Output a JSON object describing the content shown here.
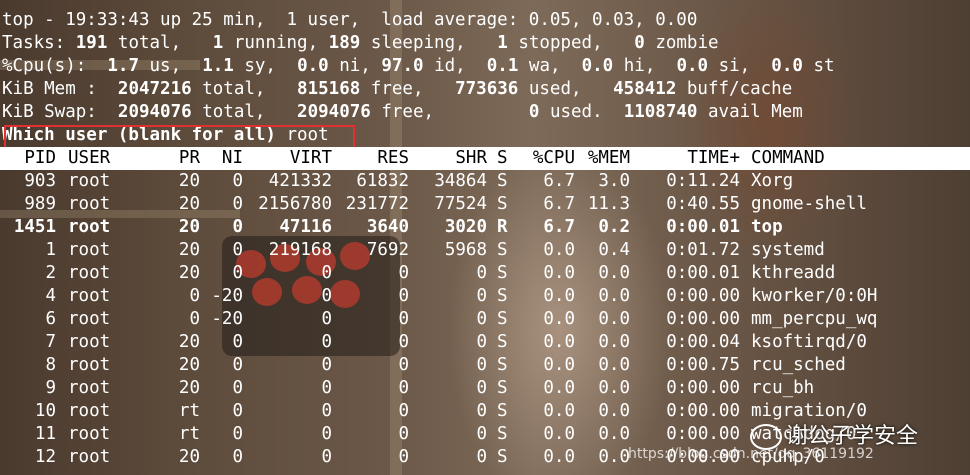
{
  "header": {
    "line1": "top - 19:33:43 up 25 min,  1 user,  load average: 0.05, 0.03, 0.00",
    "tasks": {
      "label": "Tasks:",
      "total": "191",
      "total_lbl": " total,",
      "running": "1",
      "running_lbl": " running,",
      "sleeping": "189",
      "sleeping_lbl": " sleeping,",
      "stopped": "1",
      "stopped_lbl": " stopped,",
      "zombie": "0",
      "zombie_lbl": " zombie"
    },
    "cpu": {
      "label": "%Cpu(s):",
      "us": "1.7",
      "us_lbl": " us,",
      "sy": "1.1",
      "sy_lbl": " sy,",
      "ni": "0.0",
      "ni_lbl": " ni,",
      "id": "97.0",
      "id_lbl": " id,",
      "wa": "0.1",
      "wa_lbl": " wa,",
      "hi": "0.0",
      "hi_lbl": " hi,",
      "si": "0.0",
      "si_lbl": " si,",
      "st": "0.0",
      "st_lbl": " st"
    },
    "mem": {
      "label": "KiB Mem :",
      "total": "2047216",
      "total_lbl": " total,",
      "free": "815168",
      "free_lbl": " free,",
      "used": "773636",
      "used_lbl": " used,",
      "buff": "458412",
      "buff_lbl": " buff/cache"
    },
    "swap": {
      "label": "KiB Swap:",
      "total": "2094076",
      "total_lbl": " total,",
      "free": "2094076",
      "free_lbl": " free,",
      "used": "0",
      "used_lbl": " used.",
      "avail": "1108740",
      "avail_lbl": " avail Mem"
    }
  },
  "prompt": {
    "label": "Which user (blank for all)",
    "value": "root"
  },
  "columns": [
    "PID",
    "USER",
    "PR",
    "NI",
    "VIRT",
    "RES",
    "SHR",
    "S",
    "%CPU",
    "%MEM",
    "TIME+",
    "COMMAND"
  ],
  "processes": [
    {
      "pid": "903",
      "user": "root",
      "pr": "20",
      "ni": "0",
      "virt": "421332",
      "res": "61832",
      "shr": "34864",
      "s": "S",
      "cpu": "6.7",
      "mem": "3.0",
      "time": "0:11.24",
      "cmd": "Xorg",
      "bold": false
    },
    {
      "pid": "989",
      "user": "root",
      "pr": "20",
      "ni": "0",
      "virt": "2156780",
      "res": "231772",
      "shr": "77524",
      "s": "S",
      "cpu": "6.7",
      "mem": "11.3",
      "time": "0:40.55",
      "cmd": "gnome-shell",
      "bold": false
    },
    {
      "pid": "1451",
      "user": "root",
      "pr": "20",
      "ni": "0",
      "virt": "47116",
      "res": "3640",
      "shr": "3020",
      "s": "R",
      "cpu": "6.7",
      "mem": "0.2",
      "time": "0:00.01",
      "cmd": "top",
      "bold": true
    },
    {
      "pid": "1",
      "user": "root",
      "pr": "20",
      "ni": "0",
      "virt": "219168",
      "res": "7692",
      "shr": "5968",
      "s": "S",
      "cpu": "0.0",
      "mem": "0.4",
      "time": "0:01.72",
      "cmd": "systemd",
      "bold": false
    },
    {
      "pid": "2",
      "user": "root",
      "pr": "20",
      "ni": "0",
      "virt": "0",
      "res": "0",
      "shr": "0",
      "s": "S",
      "cpu": "0.0",
      "mem": "0.0",
      "time": "0:00.01",
      "cmd": "kthreadd",
      "bold": false
    },
    {
      "pid": "4",
      "user": "root",
      "pr": "0",
      "ni": "-20",
      "virt": "0",
      "res": "0",
      "shr": "0",
      "s": "S",
      "cpu": "0.0",
      "mem": "0.0",
      "time": "0:00.00",
      "cmd": "kworker/0:0H",
      "bold": false
    },
    {
      "pid": "6",
      "user": "root",
      "pr": "0",
      "ni": "-20",
      "virt": "0",
      "res": "0",
      "shr": "0",
      "s": "S",
      "cpu": "0.0",
      "mem": "0.0",
      "time": "0:00.00",
      "cmd": "mm_percpu_wq",
      "bold": false
    },
    {
      "pid": "7",
      "user": "root",
      "pr": "20",
      "ni": "0",
      "virt": "0",
      "res": "0",
      "shr": "0",
      "s": "S",
      "cpu": "0.0",
      "mem": "0.0",
      "time": "0:00.04",
      "cmd": "ksoftirqd/0",
      "bold": false
    },
    {
      "pid": "8",
      "user": "root",
      "pr": "20",
      "ni": "0",
      "virt": "0",
      "res": "0",
      "shr": "0",
      "s": "S",
      "cpu": "0.0",
      "mem": "0.0",
      "time": "0:00.75",
      "cmd": "rcu_sched",
      "bold": false
    },
    {
      "pid": "9",
      "user": "root",
      "pr": "20",
      "ni": "0",
      "virt": "0",
      "res": "0",
      "shr": "0",
      "s": "S",
      "cpu": "0.0",
      "mem": "0.0",
      "time": "0:00.00",
      "cmd": "rcu_bh",
      "bold": false
    },
    {
      "pid": "10",
      "user": "root",
      "pr": "rt",
      "ni": "0",
      "virt": "0",
      "res": "0",
      "shr": "0",
      "s": "S",
      "cpu": "0.0",
      "mem": "0.0",
      "time": "0:00.00",
      "cmd": "migration/0",
      "bold": false
    },
    {
      "pid": "11",
      "user": "root",
      "pr": "rt",
      "ni": "0",
      "virt": "0",
      "res": "0",
      "shr": "0",
      "s": "S",
      "cpu": "0.0",
      "mem": "0.0",
      "time": "0:00.00",
      "cmd": "watchdog/0",
      "bold": false
    },
    {
      "pid": "12",
      "user": "root",
      "pr": "20",
      "ni": "0",
      "virt": "0",
      "res": "0",
      "shr": "0",
      "s": "S",
      "cpu": "0.0",
      "mem": "0.0",
      "time": "0:00.00",
      "cmd": "cpuhp/0",
      "bold": false
    }
  ],
  "watermark": {
    "text": "谢公子学安全",
    "url": "https://blog.csdn.net/qq_36119192",
    "icon": "wechat-icon"
  },
  "colors": {
    "highlight_box": "#e03030",
    "header_bar": "#ffffff",
    "text": "#ffffff"
  }
}
